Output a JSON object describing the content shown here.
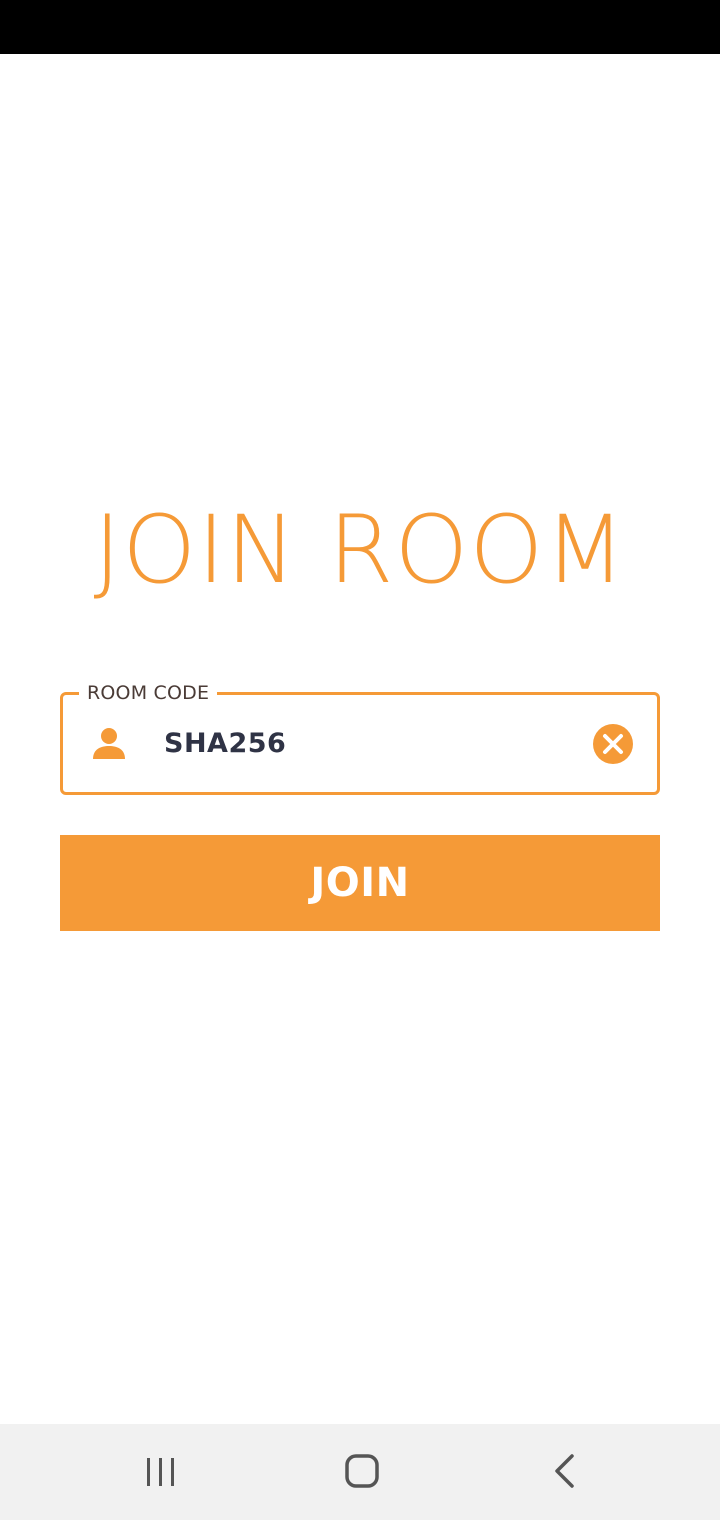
{
  "screen": {
    "title": "JOIN ROOM"
  },
  "room_code_field": {
    "label": "ROOM CODE",
    "value": "SHA256",
    "icon": "person-icon",
    "clear_icon": "clear-circle-icon"
  },
  "join_button": {
    "label": "JOIN"
  },
  "nav_bar": {
    "buttons": [
      "recent-apps-icon",
      "home-icon",
      "back-icon"
    ]
  },
  "colors": {
    "accent": "#f59a37",
    "text_dark": "#2f3345",
    "label_text": "#4a3b36",
    "status_bar": "#000000",
    "nav_bar": "#f1f1f1"
  }
}
